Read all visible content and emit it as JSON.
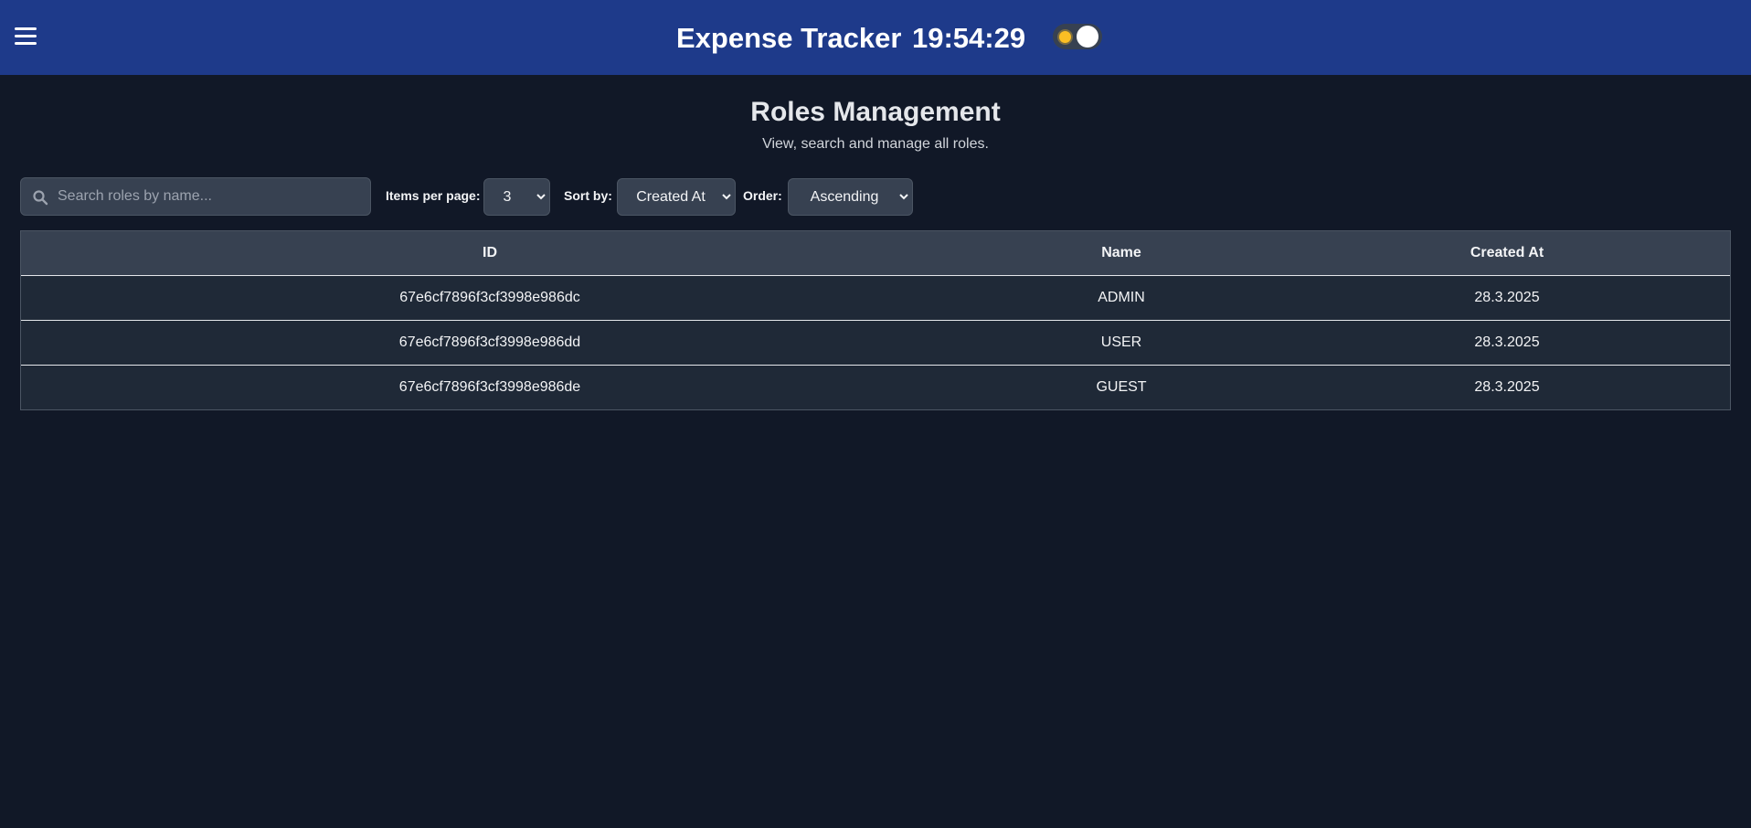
{
  "header": {
    "title": "Expense Tracker",
    "clock": "19:54:29",
    "theme_toggle_icon": "sun-icon"
  },
  "page": {
    "title": "Roles Management",
    "subtitle": "View, search and manage all roles."
  },
  "controls": {
    "search_placeholder": "Search roles by name...",
    "items_per_page_label": "Items per page:",
    "items_per_page_value": "3",
    "sort_by_label": "Sort by:",
    "sort_by_value": "Created At",
    "order_label": "Order:",
    "order_value": "Ascending"
  },
  "table": {
    "columns": [
      "ID",
      "Name",
      "Created At"
    ],
    "rows": [
      [
        "67e6cf7896f3cf3998e986dc",
        "ADMIN",
        "28.3.2025"
      ],
      [
        "67e6cf7896f3cf3998e986dd",
        "USER",
        "28.3.2025"
      ],
      [
        "67e6cf7896f3cf3998e986de",
        "GUEST",
        "28.3.2025"
      ]
    ]
  },
  "colors": {
    "header_bg": "#1e3a8a",
    "page_bg": "#111827",
    "table_head_bg": "#374151",
    "table_row_bg": "#1f2937",
    "sun": "#fbbf24"
  }
}
